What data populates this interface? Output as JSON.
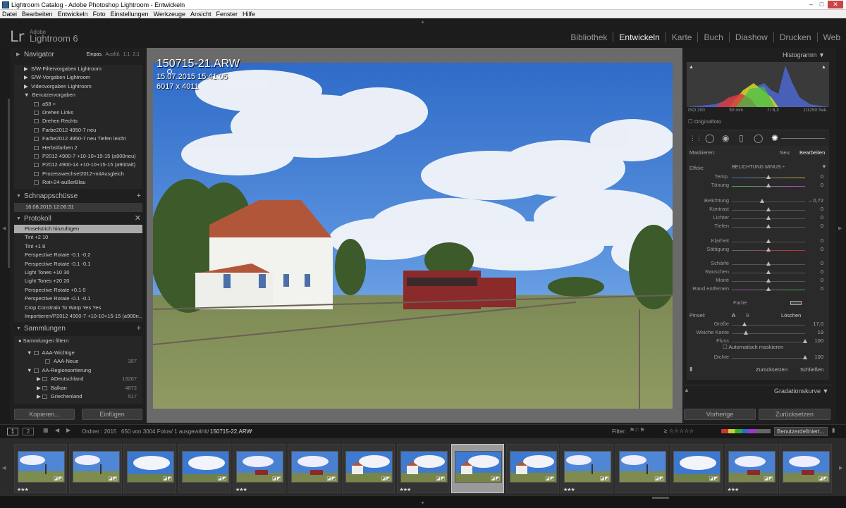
{
  "window": {
    "title": "Lightroom Catalog - Adobe Photoshop Lightroom - Entwickeln"
  },
  "menu": [
    "Datei",
    "Bearbeiten",
    "Entwickeln",
    "Foto",
    "Einstellungen",
    "Werkzeuge",
    "Ansicht",
    "Fenster",
    "Hilfe"
  ],
  "brand": {
    "logo": "Lr",
    "adobe": "Adobe",
    "product": "Lightroom 6"
  },
  "modules": [
    "Bibliothek",
    "Entwickeln",
    "Karte",
    "Buch",
    "Diashow",
    "Drucken",
    "Web"
  ],
  "navigator": {
    "title": "Navigator",
    "zoom": [
      "Einpas.",
      "Ausfül.",
      "1:1",
      "2:1"
    ]
  },
  "presets": [
    "S/W-Filtervorgaben Lightroom",
    "S/W-Vorgaben Lightroom",
    "Videovorgaben Lightroom",
    "Benutzervorgaben",
    "a58 +",
    "Drehen Links",
    "Drehen Rechts",
    "Farbe2012 4950-7 neu",
    "Farbe2012 4950-7 neu Tiefen leicht",
    "Herbstfarben 2",
    "P2012 4900-7 +10-10+15-15 (a900neu)",
    "P2012 4900-14 +10-10+15-15 (a900alt)",
    "Prozesswechsel2012-mitAusgleich",
    "Rot+24-außerBlau"
  ],
  "snapshots": {
    "title": "Schnappschüsse",
    "items": [
      "16.08.2015 12:00:31"
    ]
  },
  "history": {
    "title": "Protokoll",
    "items": [
      "Pinselstrich hinzufügen",
      "Tint  +2  10",
      "Tint  +1  8",
      "Perspective Rotate  -0.1  -0.2",
      "Perspective Rotate  -0.1  -0.1",
      "Light Tones  +10  30",
      "Light Tones  +20  20",
      "Perspective Rotate  +0.1  0",
      "Perspective Rotate  -0.1  -0.1",
      "Crop Constrain To Warp   Yes   Yes",
      "Importieren/P2012 4900-7 +10-10+15-15 (a900n..."
    ]
  },
  "collections": {
    "title": "Sammlungen",
    "filter": "Sammlungen filtern",
    "items": [
      {
        "name": "AAA-Wichtige",
        "count": ""
      },
      {
        "name": "AAA-Neue",
        "count": "357"
      },
      {
        "name": "AA-Regionsortierung",
        "count": ""
      },
      {
        "name": "ADeutschland",
        "count": "13267"
      },
      {
        "name": "Balkan",
        "count": "4872"
      },
      {
        "name": "Griechenland",
        "count": "517"
      }
    ]
  },
  "left_buttons": {
    "copy": "Kopieren...",
    "paste": "Einfügen"
  },
  "overlay": {
    "filename": "150715-21.ARW",
    "date": "15.07.2015 15:41:05",
    "size": "6017 x 4011"
  },
  "histogram": {
    "title": "Histogramm",
    "iso": "ISO 200",
    "focal": "50 mm",
    "aperture": "f / 6,3",
    "shutter": "1/1250 Sek.",
    "original": "Originalfoto"
  },
  "mask": {
    "label": "Maskieren:",
    "new": "Neu",
    "edit": "Bearbeiten",
    "effect_label": "Effekt:",
    "effect_value": "BELICHTUNG MINUS ÷"
  },
  "sliders": [
    {
      "name": "Temp.",
      "value": "0",
      "pos": 0.5
    },
    {
      "name": "Tönung",
      "value": "0",
      "pos": 0.5
    },
    {
      "name": "Belichtung",
      "value": "– 0,72",
      "pos": 0.41
    },
    {
      "name": "Kontrast",
      "value": "0",
      "pos": 0.5
    },
    {
      "name": "Lichter",
      "value": "0",
      "pos": 0.5
    },
    {
      "name": "Tiefen",
      "value": "0",
      "pos": 0.5
    },
    {
      "name": "Klarheit",
      "value": "0",
      "pos": 0.5
    },
    {
      "name": "Sättigung",
      "value": "0",
      "pos": 0.5
    },
    {
      "name": "Schärfe",
      "value": "0",
      "pos": 0.5
    },
    {
      "name": "Rauschen",
      "value": "0",
      "pos": 0.5
    },
    {
      "name": "Moiré",
      "value": "0",
      "pos": 0.5
    },
    {
      "name": "Rand entfernen",
      "value": "0",
      "pos": 0.5
    }
  ],
  "color_label": "Farbe",
  "brush": {
    "label": "Pinsel:",
    "a": "A",
    "b": "B",
    "erase": "Löschen",
    "size_label": "Größe",
    "size": "17,0",
    "size_pos": 0.17,
    "feather_label": "Weiche Kante",
    "feather": "19",
    "feather_pos": 0.19,
    "flow_label": "Fluss",
    "flow": "100",
    "flow_pos": 1.0,
    "auto_mask": "Automatisch maskieren",
    "density_label": "Dichte",
    "density": "100",
    "density_pos": 1.0,
    "reset": "Zurücksetzen",
    "close": "Schließen"
  },
  "tone_curve": "Gradationskurve",
  "right_buttons": {
    "prev": "Vorherige",
    "reset": "Zurücksetzen"
  },
  "filmbar": {
    "page1": "1",
    "page2": "2",
    "source": "Ordner : 2015",
    "count": "650 von 3004 Fotos/ 1 ausgewählt/",
    "file": "150715-22.ARW",
    "filter_label": "Filter:",
    "preset": "Benutzerdefiniert..."
  },
  "thumbnails": [
    {
      "stars": "★★★",
      "sel": false,
      "type": "a"
    },
    {
      "stars": "",
      "sel": false,
      "type": "a"
    },
    {
      "stars": "",
      "sel": false,
      "type": "b"
    },
    {
      "stars": "",
      "sel": false,
      "type": "b"
    },
    {
      "stars": "★★★",
      "sel": false,
      "type": "c"
    },
    {
      "stars": "",
      "sel": false,
      "type": "c"
    },
    {
      "stars": "",
      "sel": false,
      "type": "d"
    },
    {
      "stars": "★★★",
      "sel": false,
      "type": "d"
    },
    {
      "stars": "",
      "sel": true,
      "type": "d"
    },
    {
      "stars": "",
      "sel": false,
      "type": "d"
    },
    {
      "stars": "★★★",
      "sel": false,
      "type": "a"
    },
    {
      "stars": "",
      "sel": false,
      "type": "a"
    },
    {
      "stars": "",
      "sel": false,
      "type": "b"
    },
    {
      "stars": "★★★",
      "sel": false,
      "type": "c"
    },
    {
      "stars": "",
      "sel": false,
      "type": "c"
    }
  ]
}
